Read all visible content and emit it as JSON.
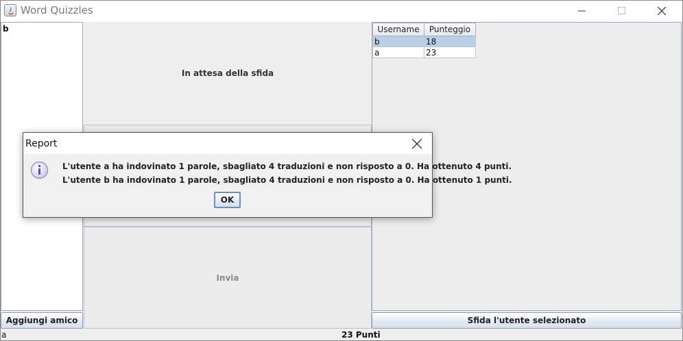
{
  "window": {
    "title": "Word Quizzles"
  },
  "friends": {
    "items": [
      "b"
    ],
    "add_button": "Aggiungi amico"
  },
  "center": {
    "status": "In attesa della sfida",
    "send_button": "Invia"
  },
  "ranking": {
    "headers": [
      "Username",
      "Punteggio"
    ],
    "rows": [
      [
        "b",
        "18"
      ],
      [
        "a",
        "23"
      ]
    ],
    "selected_row": 0,
    "challenge_button": "Sfida l'utente selezionato"
  },
  "statusbar": {
    "user": "a",
    "points": "23 Punti"
  },
  "dialog": {
    "title": "Report",
    "messages": [
      "L'utente a ha indovinato 1 parole, sbagliato 4 traduzioni e non risposto a 0. Ha ottenuto 4 punti.",
      "L'utente b ha indovinato 1 parole, sbagliato 4 traduzioni e non risposto a 0. Ha ottenuto 1 punti."
    ],
    "ok_button": "OK",
    "icon": "info-icon"
  }
}
